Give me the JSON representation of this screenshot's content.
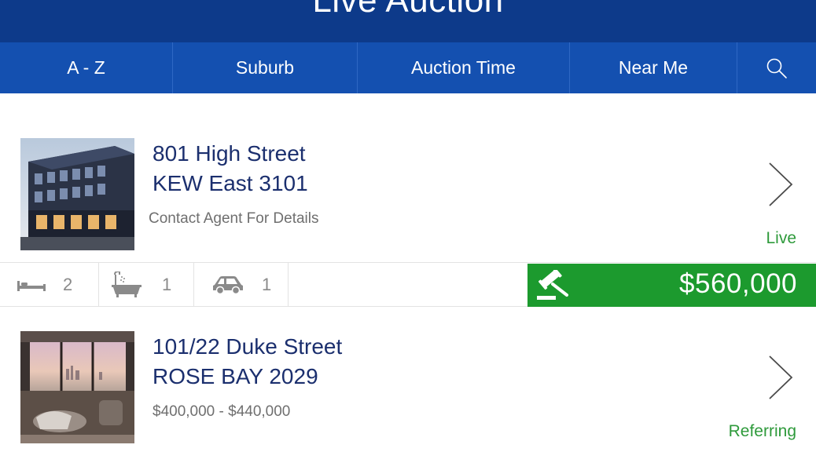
{
  "header": {
    "title": "Live Auction",
    "menu_icon": "hamburger-menu-icon"
  },
  "tabs": [
    {
      "label": "A - Z"
    },
    {
      "label": "Suburb"
    },
    {
      "label": "Auction Time"
    },
    {
      "label": "Near Me"
    },
    {
      "label": "",
      "icon": "search-icon"
    }
  ],
  "listings": [
    {
      "address_line1": "801 High Street",
      "address_line2": "KEW East 3101",
      "price_text": "Contact Agent For Details",
      "status": "Live",
      "beds": "2",
      "baths": "1",
      "cars": "1",
      "current_bid": "$560,000"
    },
    {
      "address_line1": "101/22 Duke Street",
      "address_line2": "ROSE BAY 2029",
      "price_text": "$400,000 - $440,000",
      "status": "Referring"
    }
  ],
  "colors": {
    "header_bg": "#0d3a8a",
    "tabbar_bg": "#1450b0",
    "live_green": "#2e9a3b",
    "bid_green": "#1c9a2e",
    "address_navy": "#1b2f6e"
  }
}
